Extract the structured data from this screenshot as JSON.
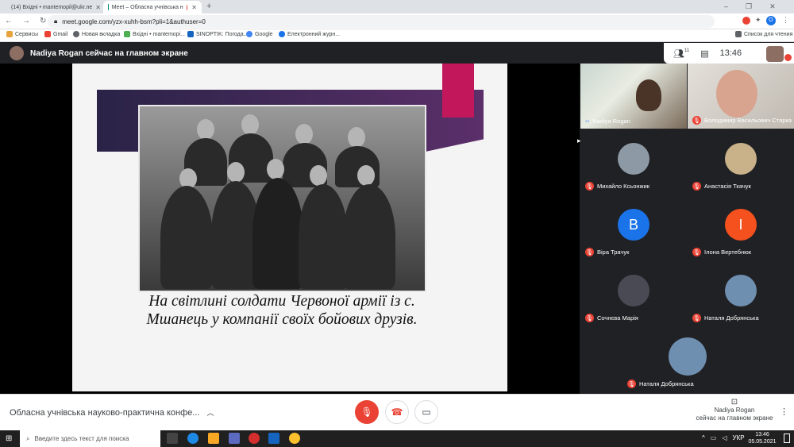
{
  "browser": {
    "tabs": [
      {
        "title": "(14) Вхідні • mantemopil@ukr.ne"
      },
      {
        "title": "Meet – Обласна учнівська н"
      }
    ],
    "new_tab_symbol": "+",
    "url": "meet.google.com/yzx-xuhh-bsm?pli=1&authuser=0",
    "profile_initial": "O",
    "bookmarks": [
      "Сервисы",
      "Gmail",
      "Новая вкладка",
      "Вхідні • mantemopi...",
      "SINOPTIK: Погода...",
      "Google",
      "Електронний журн..."
    ],
    "reading_list": "Список для чтения"
  },
  "meet": {
    "presenting_banner": "Nadiya Rogan сейчас на главном экране",
    "participants_count": "11",
    "clock": "13:46",
    "self_label": "Вы",
    "slide_caption": "На світлині солдати Червоної армії із с. Мшанець у компанії своїх бойових друзів.",
    "tiles": [
      {
        "name": "Nadiya Rogan",
        "muted": false,
        "kind": "video"
      },
      {
        "name": "Володимир Васильович Старка",
        "muted": true,
        "kind": "video"
      },
      {
        "name": "Михайло Ксьонжик",
        "muted": true,
        "kind": "photo",
        "color": "#8d9aa6"
      },
      {
        "name": "Анастасія Ткачук",
        "muted": true,
        "kind": "photo",
        "color": "#c9b28a"
      },
      {
        "name": "Віра Трачук",
        "muted": true,
        "kind": "letter",
        "letter": "В",
        "color": "#1a73e8"
      },
      {
        "name": "Ілона Вертебнюк",
        "muted": true,
        "kind": "letter",
        "letter": "І",
        "color": "#f4511e"
      },
      {
        "name": "Сочнєва Марія",
        "muted": true,
        "kind": "photo",
        "color": "#4a4a55"
      },
      {
        "name": "Наталя Добрянська",
        "muted": true,
        "kind": "photo",
        "color": "#6f8fb0"
      },
      {
        "name": "Наталя Добрянська",
        "muted": true,
        "kind": "photo",
        "color": "#6f8fb0"
      }
    ],
    "meeting_name": "Обласна учнівська науково-практична конфе...",
    "presenter_line1": "Nadiya Rogan",
    "presenter_line2": "сейчас на главном экране"
  },
  "taskbar": {
    "search_placeholder": "Введите здесь текст для поиска",
    "lang": "УКР",
    "time": "13:46",
    "date": "05.05.2021"
  },
  "colors": {
    "accent": "#1a73e8",
    "danger": "#ea4335",
    "slide_pink": "#c2185b"
  }
}
